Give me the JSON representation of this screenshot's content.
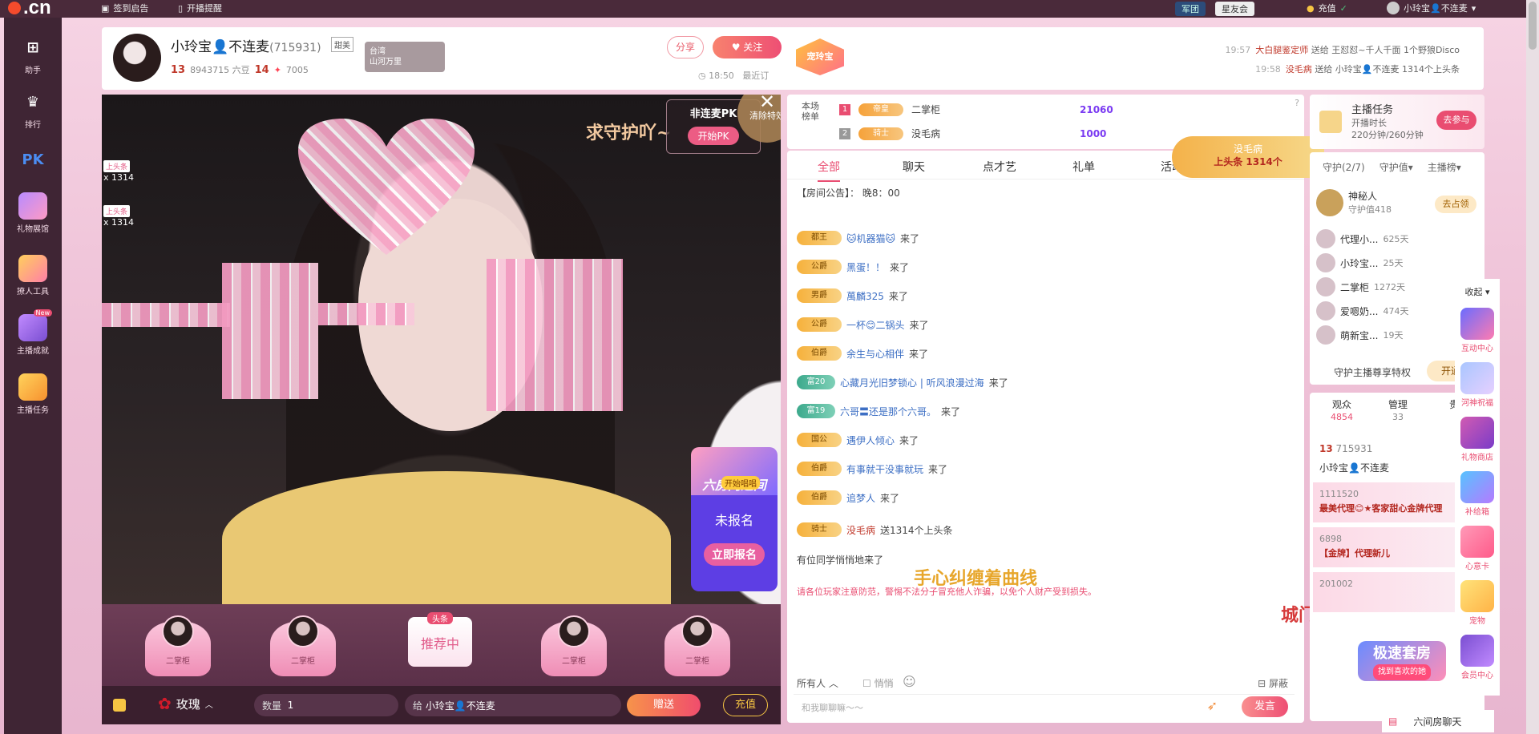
{
  "topbar": {
    "logo": ".cn",
    "sign_in": "签到启告",
    "live_remind": "开播提醒",
    "team_label": "军团",
    "star_label": "星友会",
    "recharge": "充值",
    "user_name": "小玲宝👤不连麦"
  },
  "sidebar": {
    "items": [
      {
        "label": "助手",
        "icon": "assistant-icon"
      },
      {
        "label": "排行",
        "icon": "crown-icon"
      },
      {
        "label": "",
        "icon": "pk-icon",
        "glyph": "PK"
      },
      {
        "label": "礼物展馆",
        "icon": "gift-hall-icon"
      },
      {
        "label": "撩人工具",
        "icon": "tool-icon"
      },
      {
        "label": "主播成就",
        "icon": "achievement-icon",
        "badge": "New"
      },
      {
        "label": "主播任务",
        "icon": "task-icon"
      }
    ]
  },
  "header": {
    "anchor_name": "小玲宝👤不连麦",
    "room_id": "(715931)",
    "tag": "甜美",
    "level": "13",
    "douyu_count": "8943715 六豆",
    "fans_level": "14",
    "heat": "7005",
    "geo_title": "台湾",
    "geo_sub": "山河万里",
    "share": "分享",
    "follow": "关注",
    "time": "18:50",
    "after_time": "最近订",
    "fav_badge": "宠玲宝",
    "messages": [
      {
        "time": "19:57",
        "user": "大白腿鉴定师",
        "text": "送给 王怼怼~千人千面 1个野狼Disco"
      },
      {
        "time": "19:58",
        "user": "没毛病",
        "text": "送给 小玲宝👤不连麦 1314个上头条"
      }
    ]
  },
  "video": {
    "guard_text": "求守护吖~",
    "pk_title": "非连麦PK",
    "pk_button": "开始PK",
    "clear_fx": "清除特效",
    "side_gifts": [
      {
        "chip": "上头条",
        "count": "x 1314"
      },
      {
        "chip": "上头条",
        "count": "x 1314"
      }
    ],
    "signup_live": "开始唱唱",
    "signup_title": "六房门之间",
    "signup_status": "未报名",
    "signup_button": "立即报名"
  },
  "seats": [
    {
      "name": "二掌柜"
    },
    {
      "name": "二掌柜"
    },
    {
      "name": "推荐中",
      "tag": "头条"
    },
    {
      "name": "二掌柜"
    },
    {
      "name": "二掌柜"
    }
  ],
  "giftbar": {
    "gift_name": "玫瑰",
    "quantity_label": "数量",
    "quantity_value": "1",
    "to_label": "给",
    "to_value": "小玲宝👤不连麦",
    "send": "赠送",
    "recharge": "充值"
  },
  "rank": {
    "label": "本场榜单",
    "rows": [
      {
        "n": "1",
        "badge": "帝皇",
        "name": "二掌柜",
        "points": "21060"
      },
      {
        "n": "2",
        "badge": "骑士",
        "name": "没毛病",
        "points": "1000"
      }
    ]
  },
  "chat": {
    "tabs": [
      "全部",
      "聊天",
      "点才艺",
      "礼单",
      "活动"
    ],
    "notice": "【房间公告】：  晚8：00",
    "lines": [
      {
        "rank": "都王",
        "name": "🐱机器猫🐱",
        "text": "来了"
      },
      {
        "rank": "公爵",
        "name": "黑蛋！！",
        "text": "来了"
      },
      {
        "rank": "男爵",
        "name": "萬麟325",
        "text": "来了"
      },
      {
        "rank": "公爵",
        "name": "一杯😊二锅头",
        "text": "来了"
      },
      {
        "rank": "伯爵",
        "name": "余生与心相伴",
        "text": "来了"
      },
      {
        "rank": "富20",
        "name": "心藏月光旧梦锁心 | 听风浪漫过海",
        "text": "来了"
      },
      {
        "rank": "富19",
        "name": "六哥〓还是那个六哥。",
        "text": "来了"
      },
      {
        "rank": "国公",
        "name": "遇伊人倾心",
        "text": "来了"
      },
      {
        "rank": "伯爵",
        "name": "有事就干没事就玩",
        "text": "来了"
      },
      {
        "rank": "伯爵",
        "name": "追梦人",
        "text": "来了"
      },
      {
        "rank": "骑士",
        "name": "没毛病",
        "text": "送1314个上头条"
      }
    ],
    "quiet_line": "有位同学悄悄地来了",
    "warning": "请各位玩家注意防范，警惕不法分子冒充他人诈骗，以免个人财产受到损失。",
    "input_scope": "所有人",
    "whisper": "悄悄",
    "shield": "屏蔽",
    "placeholder": "和我聊聊嘛～～",
    "send": "发言"
  },
  "lyrics": {
    "line1": "手心纠缠着曲线",
    "line2": "城门外危难之间"
  },
  "upper_strip": {
    "user": "没毛病",
    "text": "上头条 1314个"
  },
  "task": {
    "title": "主播任务",
    "line1": "开播时长",
    "line2": "220分钟/260分钟",
    "go": "去参与"
  },
  "guard": {
    "tabs": [
      "守护(2/7)",
      "守护值▾",
      "主播榜▾"
    ],
    "top_name": "神秘人",
    "top_value": "守护值418",
    "top_button": "去占领",
    "members": [
      {
        "name": "代理小...",
        "days": "625天"
      },
      {
        "name": "小玲宝...",
        "days": "25天"
      },
      {
        "name": "二掌柜",
        "days": "1272天"
      },
      {
        "name": "爱嗯奶...",
        "days": "474天"
      },
      {
        "name": "萌新宝...",
        "days": "19天"
      }
    ],
    "privilege": "守护主播尊享特权",
    "privilege_btn": "开通"
  },
  "audience": {
    "tabs": [
      {
        "label": "观众",
        "value": "4854"
      },
      {
        "label": "管理",
        "value": "33"
      },
      {
        "label": "贵",
        "value": ""
      }
    ],
    "level": "13",
    "id": "715931",
    "name": "小玲宝👤不连麦",
    "rows": [
      {
        "id": "1111520",
        "text": "最美代理😊★客家甜心金牌代理"
      },
      {
        "id": "6898",
        "text": "【金牌】代理新儿"
      },
      {
        "id": "201002",
        "text": ""
      }
    ],
    "fast_room": "极速套房",
    "fast_room_sub": "找到喜欢的她"
  },
  "tools": {
    "collapse": "收起",
    "items": [
      "互动中心",
      "河神祝福",
      "礼物商店",
      "补给箱",
      "心意卡",
      "宠物",
      "会员中心"
    ]
  },
  "bottom": {
    "room_chat": "六间房聊天"
  }
}
